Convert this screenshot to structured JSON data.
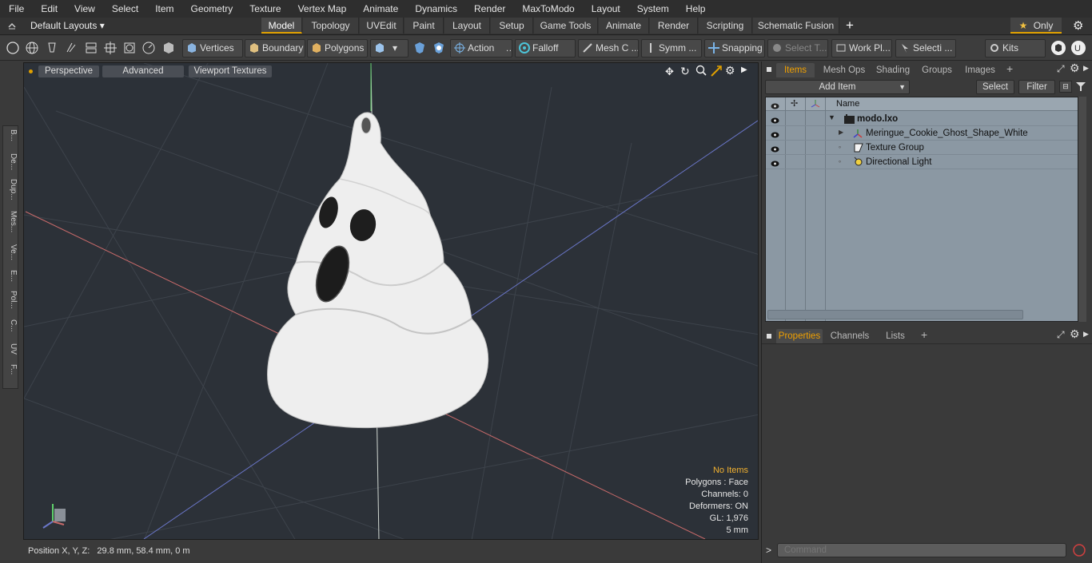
{
  "menu": [
    "File",
    "Edit",
    "View",
    "Select",
    "Item",
    "Geometry",
    "Texture",
    "Vertex Map",
    "Animate",
    "Dynamics",
    "Render",
    "MaxToModo",
    "Layout",
    "System",
    "Help"
  ],
  "layout": {
    "selector": "Default Layouts ▾",
    "tabs": [
      "Model",
      "Topology",
      "UVEdit",
      "Paint",
      "Layout",
      "Setup",
      "Game Tools",
      "Animate",
      "Render",
      "Scripting",
      "Schematic Fusion"
    ],
    "active_tab": "Model",
    "only_label": "Only"
  },
  "toolbar": {
    "vertices": "Vertices",
    "boundary": "Boundary",
    "polygons": "Polygons",
    "action": "Action",
    "falloff": "Falloff",
    "mesh_c": "Mesh C ...",
    "symm": "Symm ...",
    "snapping": "Snapping",
    "select_t": "Select T...",
    "work_pl": "Work Pl...",
    "selecti": "Selecti ...",
    "kits": "Kits"
  },
  "left_tabs": [
    "B...",
    "De...",
    "Dup...",
    "Mes...",
    "Ve...",
    "E...",
    "Pol...",
    "C...",
    "UV",
    "F..."
  ],
  "viewport": {
    "perspective": "Perspective",
    "advanced": "Advanced",
    "textures": "Viewport Textures",
    "stats": {
      "no_items": "No Items",
      "polygons": "Polygons : Face",
      "channels": "Channels: 0",
      "deformers": "Deformers: ON",
      "gl": "GL: 1,976",
      "scale": "5 mm"
    }
  },
  "status": {
    "position": "Position X, Y, Z:   29.8 mm, 58.4 mm, 0 m"
  },
  "items_panel": {
    "tabs": [
      "Items",
      "Mesh Ops",
      "Shading",
      "Groups",
      "Images"
    ],
    "active_tab": "Items",
    "add_item": "Add Item",
    "select": "Select",
    "filter": "Filter",
    "name_header": "Name",
    "rows": [
      {
        "name": "modo.lxo",
        "bold": true
      },
      {
        "name": "Meringue_Cookie_Ghost_Shape_White"
      },
      {
        "name": "Texture Group"
      },
      {
        "name": "Directional Light"
      }
    ]
  },
  "properties_panel": {
    "tabs": [
      "Properties",
      "Channels",
      "Lists"
    ],
    "active_tab": "Properties"
  },
  "command": {
    "prompt": ">",
    "placeholder": "Command"
  },
  "colors": {
    "accent": "#e0a000",
    "viewport_bg": "#2c3138",
    "item_list_bg": "#8b98a3"
  }
}
